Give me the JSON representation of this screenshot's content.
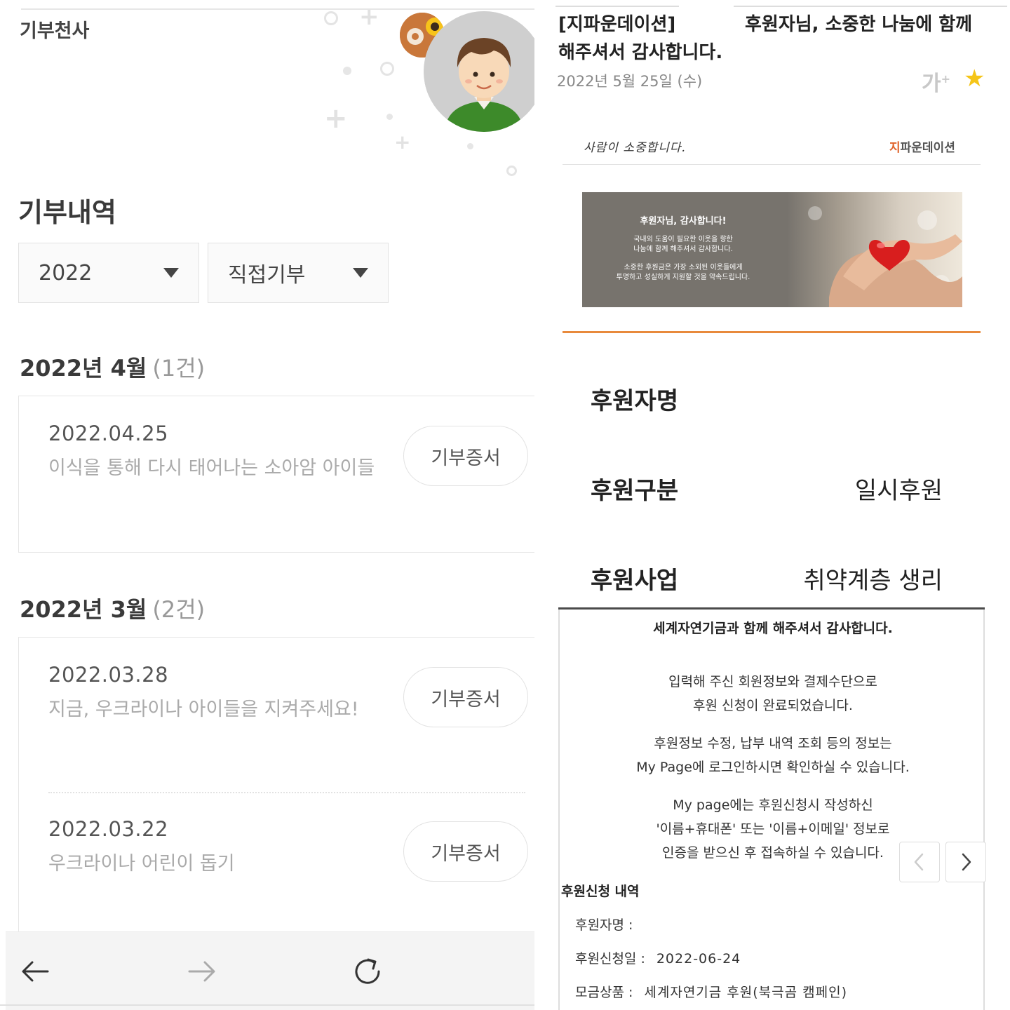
{
  "left": {
    "brand": "기부천사",
    "section_title": "기부내역",
    "filters": {
      "year": "2022",
      "type": "직접기부"
    },
    "months": [
      {
        "title": "2022년 4월",
        "count": "(1건)",
        "entries": [
          {
            "date": "2022.04.25",
            "title": "이식을 통해 다시 태어나는 소아암 아이들",
            "button": "기부증서"
          }
        ]
      },
      {
        "title": "2022년 3월",
        "count": "(2건)",
        "entries": [
          {
            "date": "2022.03.28",
            "title": "지금, 우크라이나 아이들을 지켜주세요!",
            "button": "기부증서"
          },
          {
            "date": "2022.03.22",
            "title": "우크라이나 어린이 돕기",
            "button": "기부증서"
          }
        ]
      }
    ],
    "nav": {
      "back_icon": "arrow-left-icon",
      "forward_icon": "arrow-right-icon",
      "reload_icon": "reload-icon"
    }
  },
  "right": {
    "header": {
      "line1a": "[지파운데이션]",
      "line1b": "후원자님, 소중한 나눔에 함께",
      "line2": "해주셔서 감사합니다.",
      "date": "2022년 5월 25일 (수)",
      "font_size_label": "가",
      "star_color": "#f5c518"
    },
    "email": {
      "handwriting": "사람이 소중합니다.",
      "logo_highlight": "지",
      "logo_rest": "파운데이션",
      "logo_color": "#e0632a",
      "banner": {
        "title": "후원자님, 감사합니다!",
        "line1": "국내외 도움이 필요한 이웃을 향한",
        "line2": "나눔에 함께 해주셔서 감사합니다.",
        "line3": "소중한 후원금은 가장 소외된 이웃들에게",
        "line4": "투명하고 성실하게 지원할 것을 약속드립니다."
      },
      "rows": [
        {
          "label": "후원자명",
          "value": ""
        },
        {
          "label": "후원구분",
          "value": "일시후원"
        },
        {
          "label": "후원사업",
          "value": "취약계층 생리"
        }
      ],
      "accent_color": "#e88a3c"
    },
    "confirm": {
      "title": "세계자연기금과 함께 해주셔서 감사합니다.",
      "p1a": "입력해 주신 회원정보와 결제수단으로",
      "p1b": "후원 신청이 완료되었습니다.",
      "p2a": "후원정보 수정, 납부 내역 조회 등의 정보는",
      "p2b": "My Page에 로그인하시면 확인하실 수 있습니다.",
      "p3a": "My page에는 후원신청시 작성하신",
      "p3b": "'이름+휴대폰' 또는 '이름+이메일' 정보로",
      "p3c": "인증을 받으신 후 접속하실 수 있습니다.",
      "section": "후원신청 내역",
      "rows": [
        {
          "label": "후원자명 :",
          "value": ""
        },
        {
          "label": "후원신청일 :",
          "value": "2022-06-24"
        },
        {
          "label": "모금상품 :",
          "value": "세계자연기금 후원(북극곰 캠페인)"
        }
      ],
      "prev_icon": "chevron-left-icon",
      "next_icon": "chevron-right-icon"
    }
  }
}
